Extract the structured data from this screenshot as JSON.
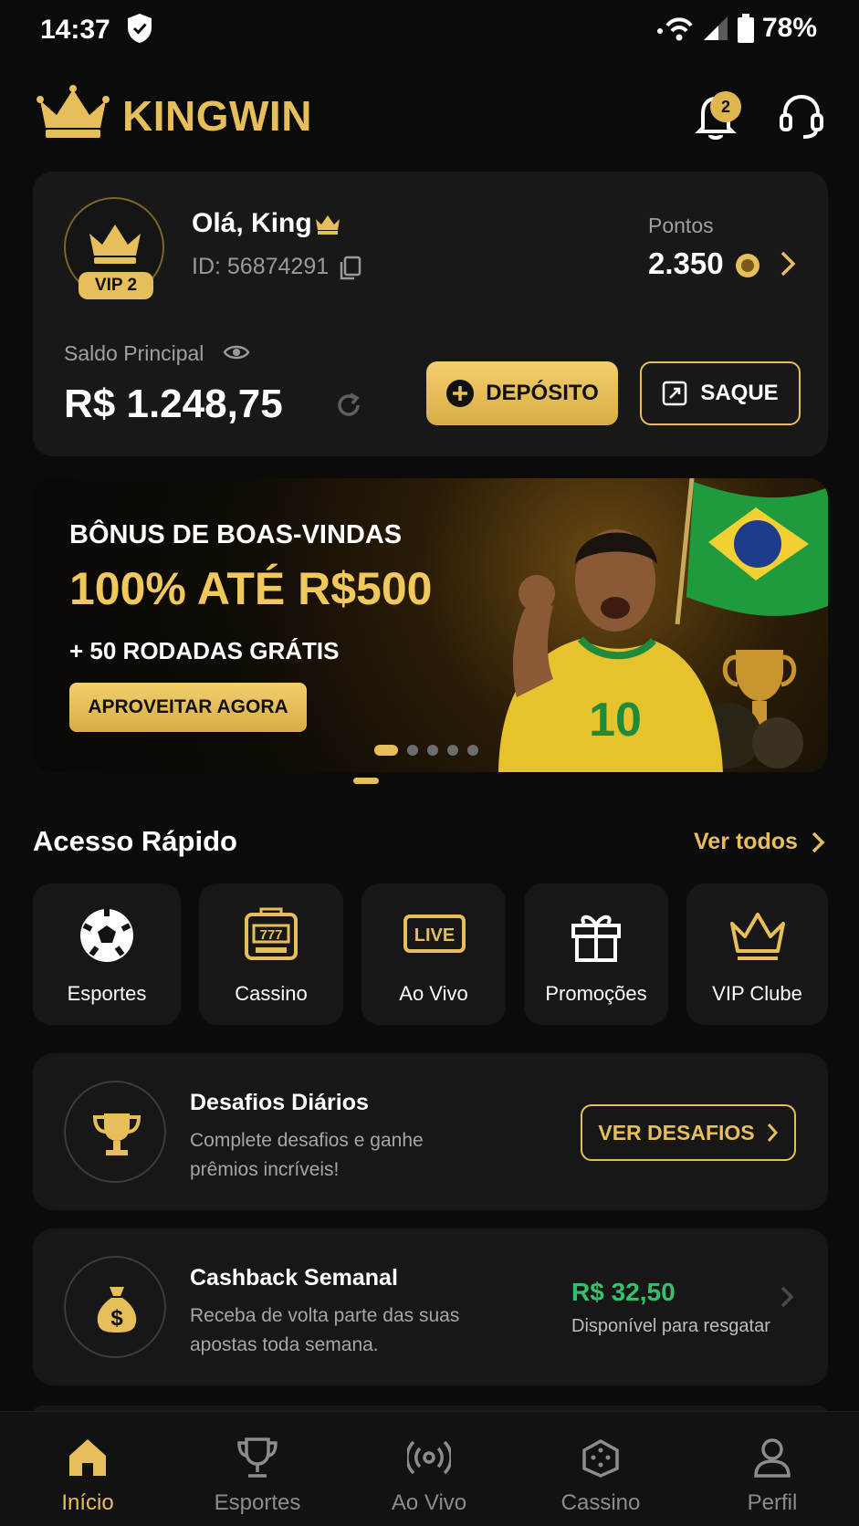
{
  "status_bar": {
    "time": "14:37",
    "battery": "78%"
  },
  "header": {
    "brand": "KINGWIN",
    "notification_count": "2"
  },
  "profile": {
    "greeting": "Olá, King",
    "user_id": "ID: 56874291",
    "vip_level": "VIP 2",
    "points_label": "Pontos",
    "points_value": "2.350",
    "balance_label": "Saldo Principal",
    "balance_value": "R$ 1.248,75",
    "deposit_label": "DEPÓSITO",
    "withdraw_label": "SAQUE"
  },
  "banner": {
    "subtitle": "BÔNUS DE BOAS-VINDAS",
    "title": "100% ATÉ R$500",
    "extra": "+ 50 RODADAS GRÁTIS",
    "cta": "APROVEITAR AGORA",
    "slide_count": 5,
    "active_slide": 1,
    "jersey_number": "10"
  },
  "quick_access": {
    "title": "Acesso Rápido",
    "see_all": "Ver todos",
    "items": [
      {
        "label": "Esportes",
        "icon": "soccer-ball-icon"
      },
      {
        "label": "Cassino",
        "icon": "slot-machine-icon"
      },
      {
        "label": "Ao Vivo",
        "icon": "live-icon"
      },
      {
        "label": "Promoções",
        "icon": "gift-icon"
      },
      {
        "label": "VIP Clube",
        "icon": "crown-icon"
      }
    ],
    "live_badge": "LIVE",
    "slot_digits": "777"
  },
  "challenges": {
    "title": "Desafios Diários",
    "description_line1": "Complete desafios e ganhe",
    "description_line2": "prêmios incríveis!",
    "button": "VER DESAFIOS"
  },
  "cashback": {
    "title": "Cashback Semanal",
    "description_line1": "Receba de volta parte das suas",
    "description_line2": "apostas toda semana.",
    "amount": "R$ 32,50",
    "note": "Disponível para resgatar"
  },
  "bottom_nav": {
    "items": [
      {
        "label": "Início",
        "icon": "home-icon",
        "active": true
      },
      {
        "label": "Esportes",
        "icon": "trophy-icon",
        "active": false
      },
      {
        "label": "Ao Vivo",
        "icon": "broadcast-icon",
        "active": false
      },
      {
        "label": "Cassino",
        "icon": "dice-icon",
        "active": false
      },
      {
        "label": "Perfil",
        "icon": "user-icon",
        "active": false
      }
    ]
  },
  "colors": {
    "accent": "#e7bf5a",
    "background": "#0b0b0b",
    "card": "#171717",
    "success": "#37c06b"
  }
}
